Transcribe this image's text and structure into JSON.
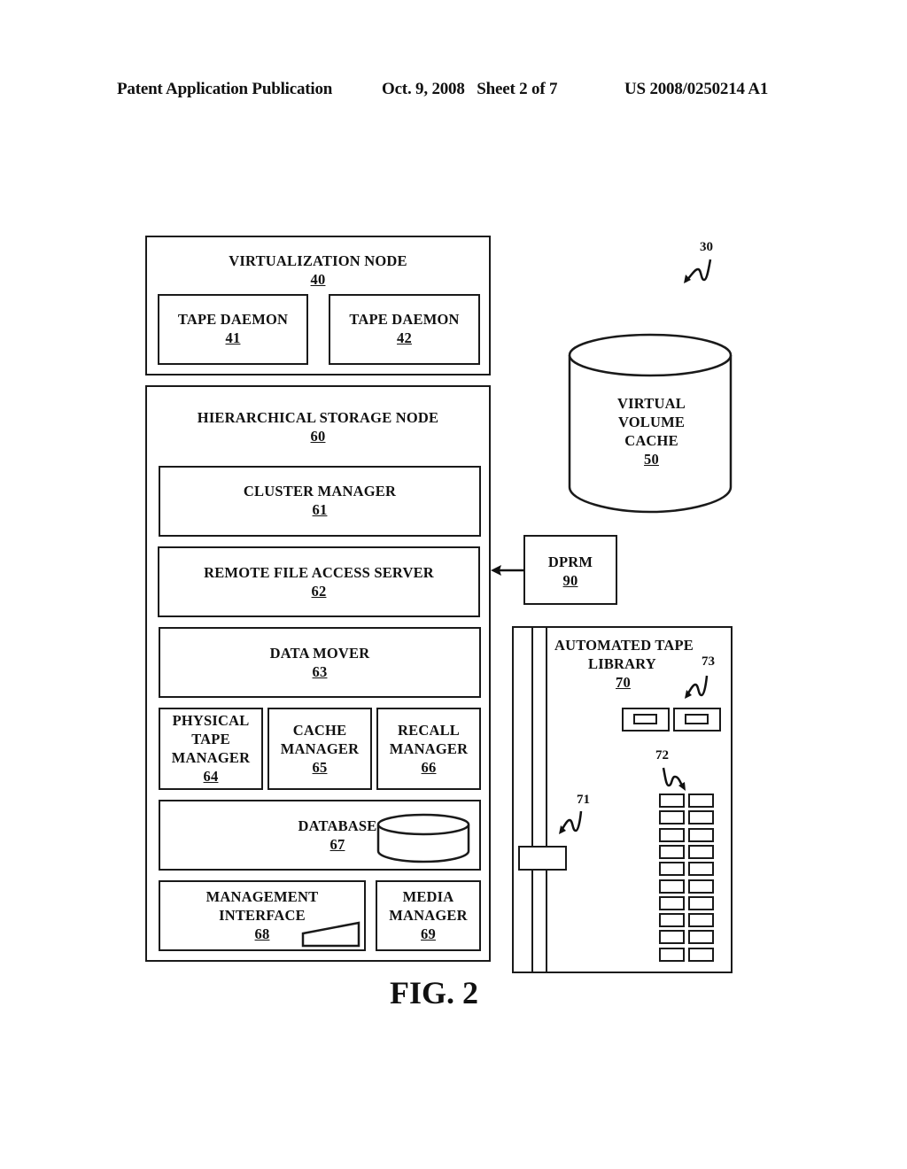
{
  "header": {
    "publication": "Patent Application Publication",
    "date_sheet": "Oct. 9, 2008   Sheet 2 of 7",
    "number": "US 2008/0250214 A1"
  },
  "figure_label": "FIG. 2",
  "system_ref": "30",
  "virtualization_node": {
    "title": "VIRTUALIZATION NODE",
    "num": "40",
    "daemons": [
      {
        "title": "TAPE DAEMON",
        "num": "41"
      },
      {
        "title": "TAPE DAEMON",
        "num": "42"
      }
    ]
  },
  "cache": {
    "lines": [
      "VIRTUAL",
      "VOLUME",
      "CACHE"
    ],
    "num": "50"
  },
  "hsm_node": {
    "title": "HIERARCHICAL STORAGE NODE",
    "num": "60",
    "cluster_manager": {
      "title": "CLUSTER MANAGER",
      "num": "61"
    },
    "remote_file_access": {
      "title": "REMOTE FILE ACCESS SERVER",
      "num": "62"
    },
    "data_mover": {
      "title": "DATA MOVER",
      "num": "63"
    },
    "physical_tape_manager": {
      "lines": [
        "PHYSICAL",
        "TAPE",
        "MANAGER"
      ],
      "num": "64"
    },
    "cache_manager": {
      "lines": [
        "CACHE",
        "MANAGER"
      ],
      "num": "65"
    },
    "recall_manager": {
      "lines": [
        "RECALL",
        "MANAGER"
      ],
      "num": "66"
    },
    "database": {
      "title": "DATABASE",
      "num": "67"
    },
    "management_interface": {
      "lines": [
        "MANAGEMENT",
        "INTERFACE"
      ],
      "num": "68"
    },
    "media_manager": {
      "lines": [
        "MEDIA",
        "MANAGER"
      ],
      "num": "69"
    }
  },
  "dprm": {
    "title": "DPRM",
    "num": "90"
  },
  "tape_library": {
    "lines": [
      "AUTOMATED TAPE",
      "LIBRARY"
    ],
    "num": "70",
    "accessor_ref": "71",
    "slots_ref": "72",
    "drives_ref": "73",
    "slot_rows": 10,
    "slot_cols": 2,
    "drive_count": 2
  }
}
